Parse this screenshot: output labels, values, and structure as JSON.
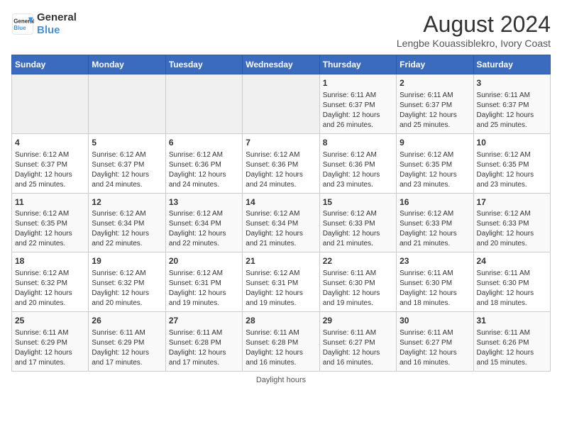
{
  "header": {
    "logo_line1": "General",
    "logo_line2": "Blue",
    "title": "August 2024",
    "subtitle": "Lengbe Kouassiblekro, Ivory Coast"
  },
  "days_of_week": [
    "Sunday",
    "Monday",
    "Tuesday",
    "Wednesday",
    "Thursday",
    "Friday",
    "Saturday"
  ],
  "weeks": [
    [
      {
        "day": "",
        "info": ""
      },
      {
        "day": "",
        "info": ""
      },
      {
        "day": "",
        "info": ""
      },
      {
        "day": "",
        "info": ""
      },
      {
        "day": "1",
        "info": "Sunrise: 6:11 AM\nSunset: 6:37 PM\nDaylight: 12 hours\nand 26 minutes."
      },
      {
        "day": "2",
        "info": "Sunrise: 6:11 AM\nSunset: 6:37 PM\nDaylight: 12 hours\nand 25 minutes."
      },
      {
        "day": "3",
        "info": "Sunrise: 6:11 AM\nSunset: 6:37 PM\nDaylight: 12 hours\nand 25 minutes."
      }
    ],
    [
      {
        "day": "4",
        "info": "Sunrise: 6:12 AM\nSunset: 6:37 PM\nDaylight: 12 hours\nand 25 minutes."
      },
      {
        "day": "5",
        "info": "Sunrise: 6:12 AM\nSunset: 6:37 PM\nDaylight: 12 hours\nand 24 minutes."
      },
      {
        "day": "6",
        "info": "Sunrise: 6:12 AM\nSunset: 6:36 PM\nDaylight: 12 hours\nand 24 minutes."
      },
      {
        "day": "7",
        "info": "Sunrise: 6:12 AM\nSunset: 6:36 PM\nDaylight: 12 hours\nand 24 minutes."
      },
      {
        "day": "8",
        "info": "Sunrise: 6:12 AM\nSunset: 6:36 PM\nDaylight: 12 hours\nand 23 minutes."
      },
      {
        "day": "9",
        "info": "Sunrise: 6:12 AM\nSunset: 6:35 PM\nDaylight: 12 hours\nand 23 minutes."
      },
      {
        "day": "10",
        "info": "Sunrise: 6:12 AM\nSunset: 6:35 PM\nDaylight: 12 hours\nand 23 minutes."
      }
    ],
    [
      {
        "day": "11",
        "info": "Sunrise: 6:12 AM\nSunset: 6:35 PM\nDaylight: 12 hours\nand 22 minutes."
      },
      {
        "day": "12",
        "info": "Sunrise: 6:12 AM\nSunset: 6:34 PM\nDaylight: 12 hours\nand 22 minutes."
      },
      {
        "day": "13",
        "info": "Sunrise: 6:12 AM\nSunset: 6:34 PM\nDaylight: 12 hours\nand 22 minutes."
      },
      {
        "day": "14",
        "info": "Sunrise: 6:12 AM\nSunset: 6:34 PM\nDaylight: 12 hours\nand 21 minutes."
      },
      {
        "day": "15",
        "info": "Sunrise: 6:12 AM\nSunset: 6:33 PM\nDaylight: 12 hours\nand 21 minutes."
      },
      {
        "day": "16",
        "info": "Sunrise: 6:12 AM\nSunset: 6:33 PM\nDaylight: 12 hours\nand 21 minutes."
      },
      {
        "day": "17",
        "info": "Sunrise: 6:12 AM\nSunset: 6:33 PM\nDaylight: 12 hours\nand 20 minutes."
      }
    ],
    [
      {
        "day": "18",
        "info": "Sunrise: 6:12 AM\nSunset: 6:32 PM\nDaylight: 12 hours\nand 20 minutes."
      },
      {
        "day": "19",
        "info": "Sunrise: 6:12 AM\nSunset: 6:32 PM\nDaylight: 12 hours\nand 20 minutes."
      },
      {
        "day": "20",
        "info": "Sunrise: 6:12 AM\nSunset: 6:31 PM\nDaylight: 12 hours\nand 19 minutes."
      },
      {
        "day": "21",
        "info": "Sunrise: 6:12 AM\nSunset: 6:31 PM\nDaylight: 12 hours\nand 19 minutes."
      },
      {
        "day": "22",
        "info": "Sunrise: 6:11 AM\nSunset: 6:30 PM\nDaylight: 12 hours\nand 19 minutes."
      },
      {
        "day": "23",
        "info": "Sunrise: 6:11 AM\nSunset: 6:30 PM\nDaylight: 12 hours\nand 18 minutes."
      },
      {
        "day": "24",
        "info": "Sunrise: 6:11 AM\nSunset: 6:30 PM\nDaylight: 12 hours\nand 18 minutes."
      }
    ],
    [
      {
        "day": "25",
        "info": "Sunrise: 6:11 AM\nSunset: 6:29 PM\nDaylight: 12 hours\nand 17 minutes."
      },
      {
        "day": "26",
        "info": "Sunrise: 6:11 AM\nSunset: 6:29 PM\nDaylight: 12 hours\nand 17 minutes."
      },
      {
        "day": "27",
        "info": "Sunrise: 6:11 AM\nSunset: 6:28 PM\nDaylight: 12 hours\nand 17 minutes."
      },
      {
        "day": "28",
        "info": "Sunrise: 6:11 AM\nSunset: 6:28 PM\nDaylight: 12 hours\nand 16 minutes."
      },
      {
        "day": "29",
        "info": "Sunrise: 6:11 AM\nSunset: 6:27 PM\nDaylight: 12 hours\nand 16 minutes."
      },
      {
        "day": "30",
        "info": "Sunrise: 6:11 AM\nSunset: 6:27 PM\nDaylight: 12 hours\nand 16 minutes."
      },
      {
        "day": "31",
        "info": "Sunrise: 6:11 AM\nSunset: 6:26 PM\nDaylight: 12 hours\nand 15 minutes."
      }
    ]
  ],
  "footer": {
    "daylight_label": "Daylight hours"
  }
}
